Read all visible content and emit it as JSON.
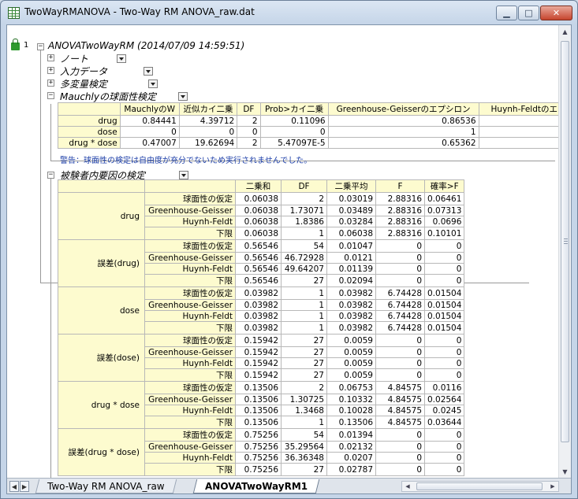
{
  "window": {
    "title": "TwoWayRMANOVA - Two-Way RM ANOVA_raw.dat"
  },
  "report": {
    "row_number": "1",
    "header": "ANOVATwoWayRM (2014/07/09 14:59:51)",
    "sections": {
      "notes": "ノート",
      "input": "入力データ",
      "multi": "多変量検定",
      "mauchly": "Mauchlyの球面性検定",
      "within": "被験者内要因の検定"
    }
  },
  "mauchly": {
    "columns": [
      "MauchlyのW",
      "近似カイ二乗",
      "DF",
      "Prob>カイ二乗",
      "Greenhouse-Geisserのエプシロン",
      "Huynh-Feldtのエ"
    ],
    "rows": [
      {
        "label": "drug",
        "values": [
          "0.84441",
          "4.39712",
          "2",
          "0.11096",
          "0.86536",
          ""
        ]
      },
      {
        "label": "dose",
        "values": [
          "0",
          "0",
          "0",
          "0",
          "1",
          ""
        ]
      },
      {
        "label": "drug * dose",
        "values": [
          "0.47007",
          "19.62694",
          "2",
          "5.47097E-5",
          "0.65362",
          ""
        ]
      }
    ],
    "warning": "警告：球面性の検定は自由度が充分でないため実行されませんでした。"
  },
  "within": {
    "columns": [
      "二乗和",
      "DF",
      "二乗平均",
      "F",
      "確率>F"
    ],
    "groups": [
      {
        "label": "drug",
        "rows": [
          {
            "sub": "球面性の仮定",
            "values": [
              "0.06038",
              "2",
              "0.03019",
              "2.88316",
              "0.06461"
            ]
          },
          {
            "sub": "Greenhouse-Geisser",
            "values": [
              "0.06038",
              "1.73071",
              "0.03489",
              "2.88316",
              "0.07313"
            ]
          },
          {
            "sub": "Huynh-Feldt",
            "values": [
              "0.06038",
              "1.8386",
              "0.03284",
              "2.88316",
              "0.0696"
            ]
          },
          {
            "sub": "下限",
            "values": [
              "0.06038",
              "1",
              "0.06038",
              "2.88316",
              "0.10101"
            ]
          }
        ]
      },
      {
        "label": "誤差(drug)",
        "rows": [
          {
            "sub": "球面性の仮定",
            "values": [
              "0.56546",
              "54",
              "0.01047",
              "0",
              "0"
            ]
          },
          {
            "sub": "Greenhouse-Geisser",
            "values": [
              "0.56546",
              "46.72928",
              "0.0121",
              "0",
              "0"
            ]
          },
          {
            "sub": "Huynh-Feldt",
            "values": [
              "0.56546",
              "49.64207",
              "0.01139",
              "0",
              "0"
            ]
          },
          {
            "sub": "下限",
            "values": [
              "0.56546",
              "27",
              "0.02094",
              "0",
              "0"
            ]
          }
        ]
      },
      {
        "label": "dose",
        "rows": [
          {
            "sub": "球面性の仮定",
            "values": [
              "0.03982",
              "1",
              "0.03982",
              "6.74428",
              "0.01504"
            ]
          },
          {
            "sub": "Greenhouse-Geisser",
            "values": [
              "0.03982",
              "1",
              "0.03982",
              "6.74428",
              "0.01504"
            ]
          },
          {
            "sub": "Huynh-Feldt",
            "values": [
              "0.03982",
              "1",
              "0.03982",
              "6.74428",
              "0.01504"
            ]
          },
          {
            "sub": "下限",
            "values": [
              "0.03982",
              "1",
              "0.03982",
              "6.74428",
              "0.01504"
            ]
          }
        ]
      },
      {
        "label": "誤差(dose)",
        "rows": [
          {
            "sub": "球面性の仮定",
            "values": [
              "0.15942",
              "27",
              "0.0059",
              "0",
              "0"
            ]
          },
          {
            "sub": "Greenhouse-Geisser",
            "values": [
              "0.15942",
              "27",
              "0.0059",
              "0",
              "0"
            ]
          },
          {
            "sub": "Huynh-Feldt",
            "values": [
              "0.15942",
              "27",
              "0.0059",
              "0",
              "0"
            ]
          },
          {
            "sub": "下限",
            "values": [
              "0.15942",
              "27",
              "0.0059",
              "0",
              "0"
            ]
          }
        ]
      },
      {
        "label": "drug * dose",
        "rows": [
          {
            "sub": "球面性の仮定",
            "values": [
              "0.13506",
              "2",
              "0.06753",
              "4.84575",
              "0.0116"
            ]
          },
          {
            "sub": "Greenhouse-Geisser",
            "values": [
              "0.13506",
              "1.30725",
              "0.10332",
              "4.84575",
              "0.02564"
            ]
          },
          {
            "sub": "Huynh-Feldt",
            "values": [
              "0.13506",
              "1.3468",
              "0.10028",
              "4.84575",
              "0.0245"
            ]
          },
          {
            "sub": "下限",
            "values": [
              "0.13506",
              "1",
              "0.13506",
              "4.84575",
              "0.03644"
            ]
          }
        ]
      },
      {
        "label": "誤差(drug * dose)",
        "rows": [
          {
            "sub": "球面性の仮定",
            "values": [
              "0.75256",
              "54",
              "0.01394",
              "0",
              "0"
            ]
          },
          {
            "sub": "Greenhouse-Geisser",
            "values": [
              "0.75256",
              "35.29564",
              "0.02132",
              "0",
              "0"
            ]
          },
          {
            "sub": "Huynh-Feldt",
            "values": [
              "0.75256",
              "36.36348",
              "0.0207",
              "0",
              "0"
            ]
          },
          {
            "sub": "下限",
            "values": [
              "0.75256",
              "27",
              "0.02787",
              "0",
              "0"
            ]
          }
        ]
      }
    ]
  },
  "tabs": [
    {
      "label": "Two-Way RM ANOVA_raw"
    },
    {
      "label": "ANOVATwoWayRM1"
    }
  ]
}
